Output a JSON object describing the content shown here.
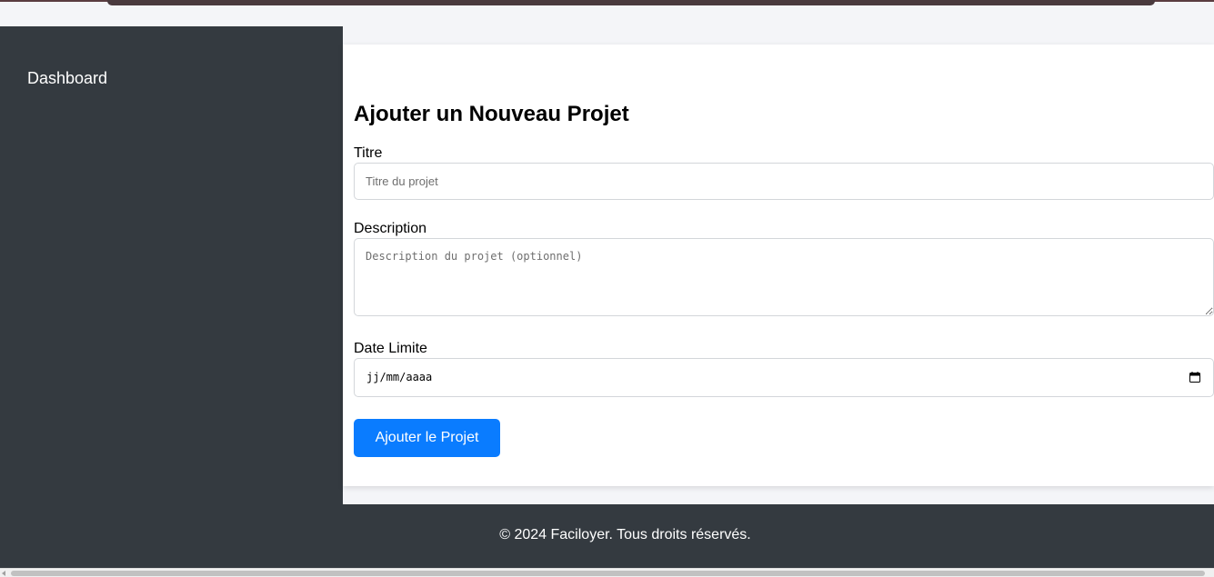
{
  "sidebar": {
    "items": [
      {
        "label": "Dashboard"
      }
    ]
  },
  "form": {
    "title": "Ajouter un Nouveau Projet",
    "fields": {
      "title": {
        "label": "Titre",
        "placeholder": "Titre du projet",
        "value": ""
      },
      "description": {
        "label": "Description",
        "placeholder": "Description du projet (optionnel)",
        "value": ""
      },
      "deadline": {
        "label": "Date Limite",
        "placeholder": "jj/mm/aaaa",
        "icon": "calendar-icon"
      }
    },
    "submit_label": "Ajouter le Projet"
  },
  "footer": {
    "text": "© 2024 Faciloyer. Tous droits réservés."
  },
  "colors": {
    "sidebar_bg": "#343a40",
    "primary": "#0a7cff",
    "page_bg": "#f4f5f8"
  }
}
